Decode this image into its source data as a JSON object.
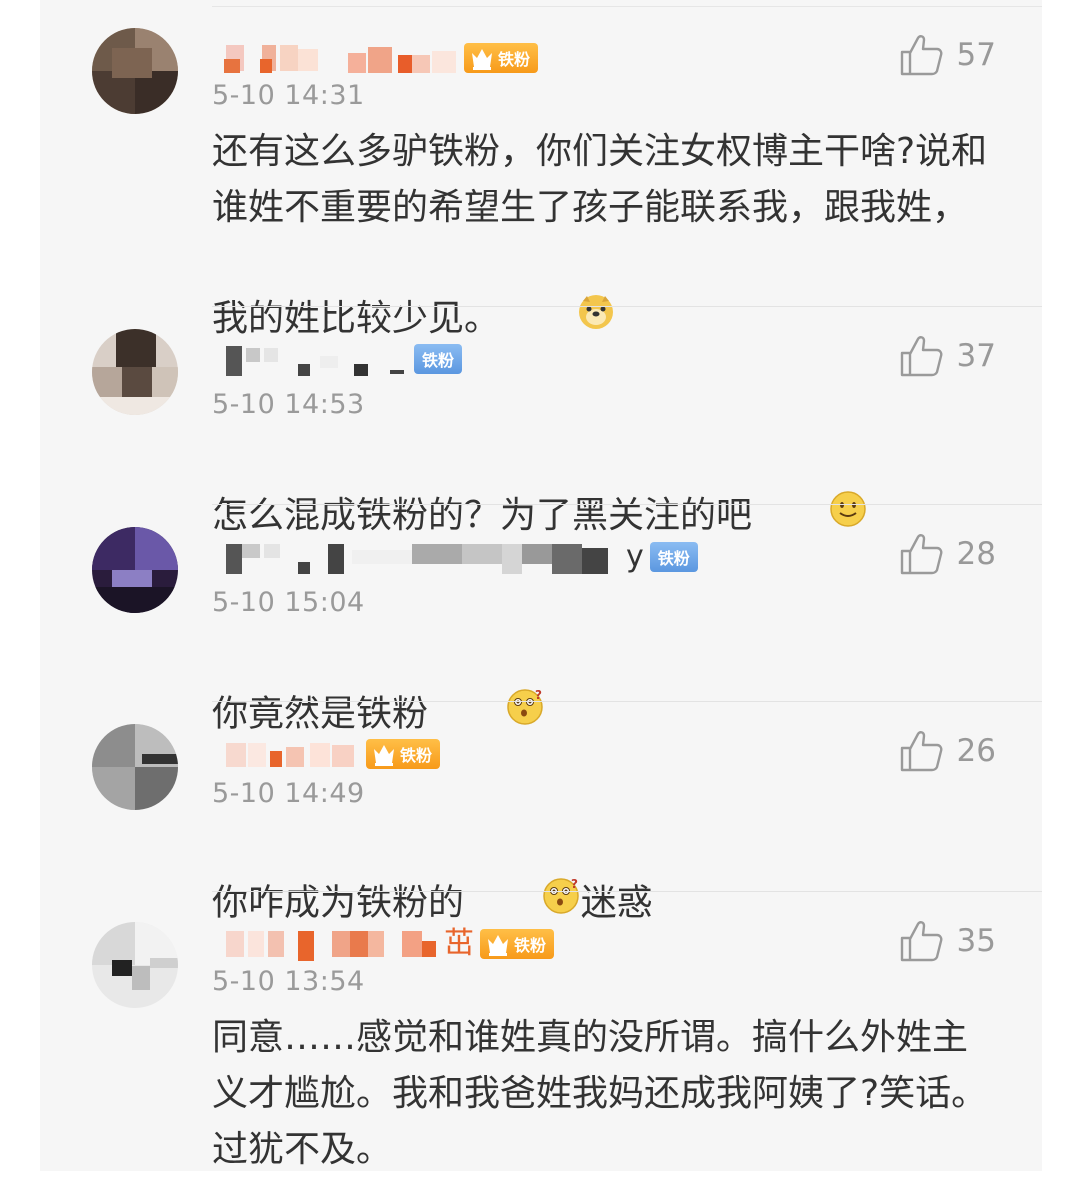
{
  "colors": {
    "background": "#f6f6f6",
    "text": "#333333",
    "meta": "#9a9a9a",
    "badge_orange": "#f79a1a",
    "badge_blue": "#5b97e0"
  },
  "comments": [
    {
      "name_visible": "",
      "badge": {
        "label": "铁粉",
        "style": "orange",
        "level": "6"
      },
      "time": "5-10 14:31",
      "likes": "57",
      "text": "还有这么多驴铁粉，你们关注女权博主干啥?说和谁姓不重要的希望生了孩子能联系我，跟我姓，我的姓比较少见。",
      "emoji": "doge-emoji"
    },
    {
      "name_visible": "",
      "badge": {
        "label": "铁粉",
        "style": "blue"
      },
      "time": "5-10 14:53",
      "likes": "37",
      "text": "怎么混成铁粉的？为了黑关注的吧",
      "emoji": "smile-emoji"
    },
    {
      "name_visible": "y",
      "badge": {
        "label": "铁粉",
        "style": "blue"
      },
      "time": "5-10 15:04",
      "likes": "28",
      "text": "你竟然是铁粉",
      "emoji": "confused-emoji"
    },
    {
      "name_visible": "",
      "badge": {
        "label": "铁粉",
        "style": "orange",
        "level": "3"
      },
      "time": "5-10 14:49",
      "likes": "26",
      "text": "你咋成为铁粉的",
      "emoji": "confused-emoji",
      "text_after": "迷惑"
    },
    {
      "name_visible": "茁",
      "badge": {
        "label": "铁粉",
        "style": "orange",
        "level": ""
      },
      "time": "5-10 13:54",
      "likes": "35",
      "text": "同意……感觉和谁姓真的没所谓。搞什么外姓主义才尴尬。我和我爸姓我妈还成我阿姨了?笑话。过犹不及。",
      "emoji": ""
    }
  ]
}
